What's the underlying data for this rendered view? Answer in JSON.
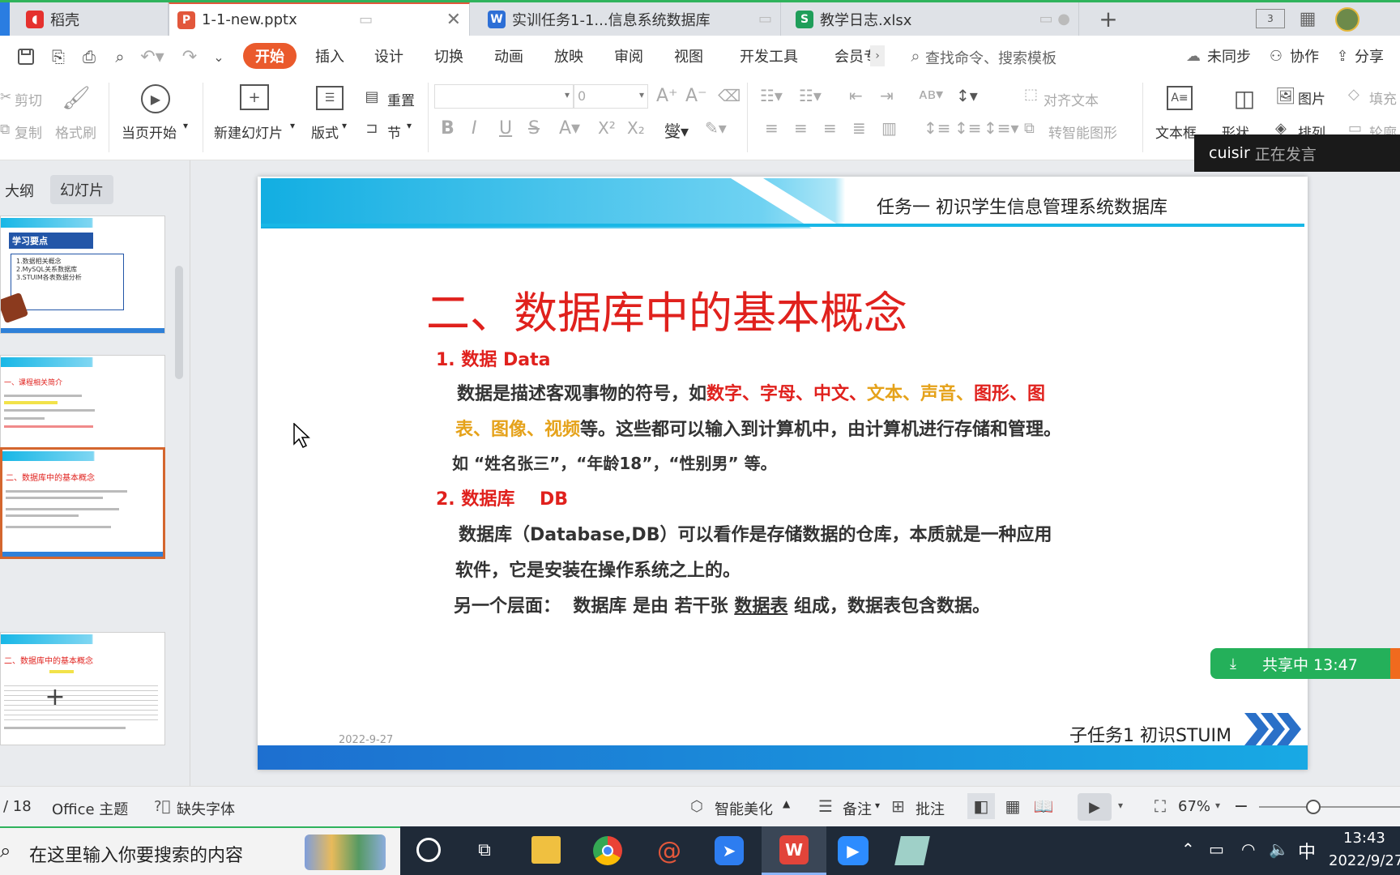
{
  "tabs": [
    {
      "label": "稻壳",
      "logo": "稻-logo-icon"
    },
    {
      "label": "1-1-new.pptx",
      "logo": "P"
    },
    {
      "label": "实训任务1-1...信息系统数据库",
      "logo": "W"
    },
    {
      "label": "教学日志.xlsx",
      "logo": "S"
    }
  ],
  "menu": {
    "start": "开始",
    "items": [
      "插入",
      "设计",
      "切换",
      "动画",
      "放映",
      "审阅",
      "视图",
      "开发工具",
      "会员专"
    ],
    "search_placeholder": "查找命令、搜索模板",
    "sync": "未同步",
    "collab": "协作",
    "share": "分享"
  },
  "ribbon": {
    "cut": "剪切",
    "copy": "复制",
    "format_painter": "格式刷",
    "play_from_current": "当页开始",
    "new_slide": "新建幻灯片",
    "layout": "版式",
    "reset": "重置",
    "section": "节",
    "font_size": "0",
    "align_text": "对齐文本",
    "smart_shape": "转智能图形",
    "textbox": "文本框",
    "shape": "形状",
    "picture": "图片",
    "arrange": "排列",
    "fill": "填充",
    "outline": "轮廓"
  },
  "speaker": {
    "name": "cuisir",
    "status": "正在发言"
  },
  "panel": {
    "outline_tab": "大纲",
    "slides_tab": "幻灯片"
  },
  "thumbs": [
    {
      "title": "学习要点",
      "lines": [
        "1.数据相关概念",
        "2.MySQL关系数据库",
        "3.STUIM各表数据分析"
      ]
    },
    {
      "title": "一、课程相关简介"
    },
    {
      "title": "二、数据库中的基本概念"
    },
    {
      "title": "二、数据库中的基本概念"
    }
  ],
  "slide": {
    "header": "任务一  初识学生信息管理系统数据库",
    "title": "二、数据库中的基本概念",
    "h1": "1. 数据  Data",
    "p1_pre": "数据是描述客观事物的符号，如",
    "p1_red1": "数字、字母、中文、",
    "p1_gold1": "文本、声音、",
    "p1_red2": "图形、图",
    "p1_gold2": "表、图像、视频",
    "p1_post": "等。这些都可以输入到计算机中，由计算机进行存储和管理。",
    "p1_example": "如 “姓名张三”，“年龄18”，“性别男” 等。",
    "h2": "2. 数据库    DB",
    "p2_line1": "数据库（Database,DB）可以看作是存储数据的仓库，本质就是一种应用",
    "p2_line2": "软件，它是安装在操作系统之上的。",
    "p3_pre": "另一个层面：  数据库 是由 若干张 ",
    "p3_link": "数据表",
    "p3_post": " 组成，数据表包含数据。",
    "date": "2022-9-27",
    "footer": "子任务1 初识STUIM"
  },
  "sharing": {
    "label": "共享中 13:47"
  },
  "status": {
    "page": "/ 18",
    "theme": "Office 主题",
    "missing_font": "缺失字体",
    "beautify": "智能美化",
    "notes": "备注",
    "comments": "批注",
    "zoom": "67%"
  },
  "taskbar": {
    "search_placeholder": "在这里输入你要搜索的内容",
    "ime": "中",
    "time": "13:43",
    "date": "2022/9/27"
  },
  "colors": {
    "accent": "#ea5a2c",
    "title_red": "#e0211d",
    "highlight_gold": "#e5a21a",
    "sharing_green": "#2fb35c"
  }
}
